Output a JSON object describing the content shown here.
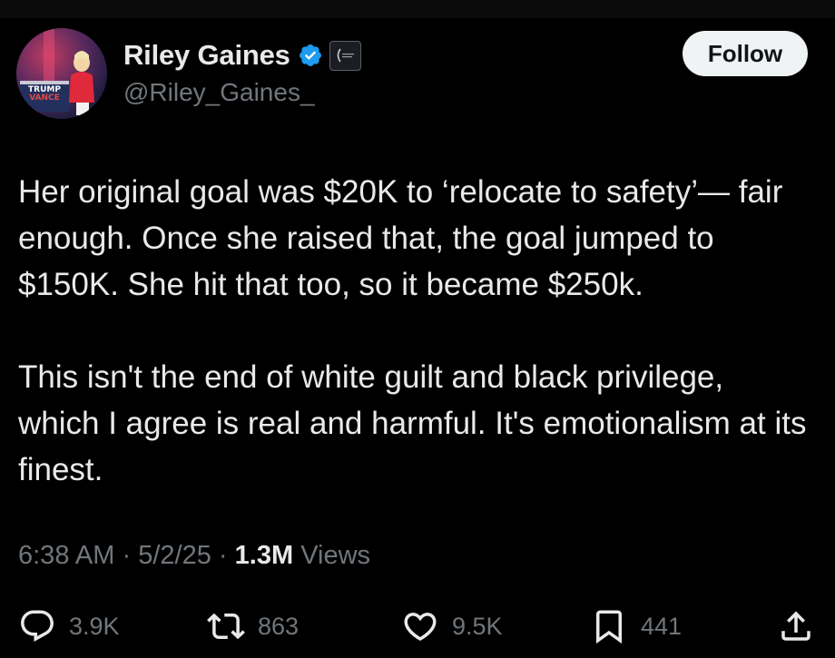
{
  "author": {
    "display_name": "Riley Gaines",
    "handle": "@Riley_Gaines_",
    "verified_icon": "verified-badge-icon",
    "affiliation_icon": "affiliate-badge-icon",
    "avatar_sign_lines": [
      "TRUMP",
      "VANCE"
    ]
  },
  "follow_button": {
    "label": "Follow"
  },
  "tweet": {
    "paragraphs": [
      "Her original goal was $20K to ‘relocate to safety’— fair enough. Once she raised that, the goal jumped to $150K. She hit that too, so it became $250k.",
      "This isn't the end of white guilt and black privilege, which I agree is real and harmful. It's emotionalism at its finest."
    ]
  },
  "meta": {
    "time": "6:38 AM",
    "separator": "·",
    "date": "5/2/25",
    "views_count": "1.3M",
    "views_label": "Views"
  },
  "actions": {
    "reply": {
      "icon": "reply-icon",
      "count": "3.9K"
    },
    "repost": {
      "icon": "repost-icon",
      "count": "863"
    },
    "like": {
      "icon": "heart-icon",
      "count": "9.5K"
    },
    "bookmark": {
      "icon": "bookmark-icon",
      "count": "441"
    },
    "share": {
      "icon": "share-icon"
    }
  },
  "colors": {
    "background": "#000000",
    "text_primary": "#e7e9ea",
    "text_secondary": "#71767b",
    "verified_blue": "#1d9bf0",
    "follow_bg": "#eff3f4"
  }
}
